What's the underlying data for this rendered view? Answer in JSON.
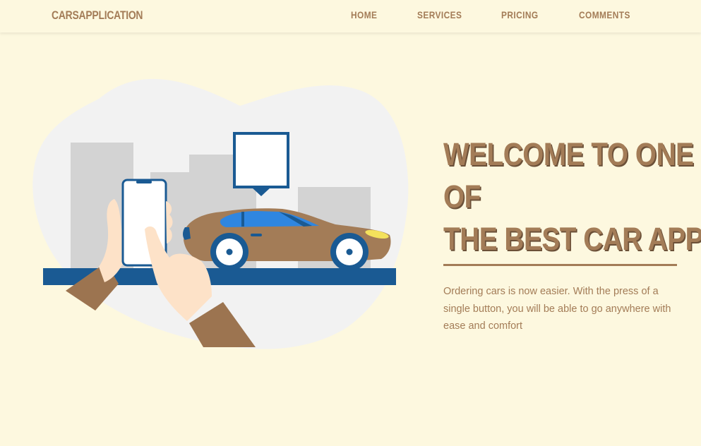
{
  "header": {
    "brand": "CARSAPPLICATION",
    "nav": {
      "home": "HOME",
      "services": "SERVICES",
      "pricing": "PRICING",
      "comments": "COMMENTS"
    }
  },
  "hero": {
    "title_line1": "WELCOME TO ONE",
    "title_line2": "OF",
    "title_line3": "THE BEST CAR APPS",
    "description": "Ordering cars is now easier. With the press of a single button, you will be able to go anywhere with ease and comfort"
  },
  "colors": {
    "background": "#fdf8df",
    "accent": "#a37c57",
    "road": "#1a5a93",
    "car_window": "#2f86e0",
    "building": "#d3d3d3",
    "blob": "#f2f2f2"
  },
  "icons": {
    "illustration": "person-phone-car-illustration"
  }
}
